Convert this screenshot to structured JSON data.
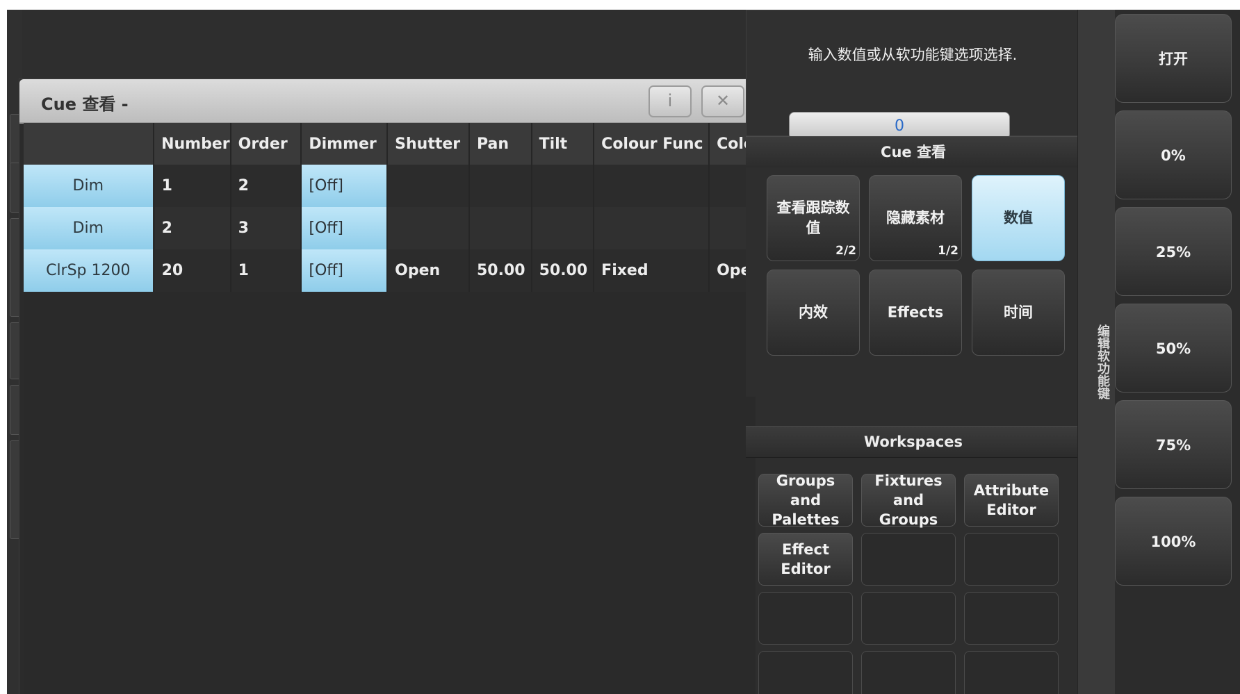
{
  "window": {
    "title": "Cue 查看 -",
    "info_button": "i",
    "close_button": "✕"
  },
  "table": {
    "columns": [
      "",
      "Number",
      "Order",
      "Dimmer",
      "Shutter",
      "Pan",
      "Tilt",
      "Colour Func",
      "Colo"
    ],
    "rows": [
      [
        "Dim",
        "1",
        "2",
        "[Off]",
        "",
        "",
        "",
        "",
        ""
      ],
      [
        "Dim",
        "2",
        "3",
        "[Off]",
        "",
        "",
        "",
        "",
        ""
      ],
      [
        "ClrSp 1200",
        "20",
        "1",
        "[Off]",
        "Open",
        "50.00",
        "50.00",
        "Fixed",
        "Ope"
      ]
    ]
  },
  "prompt": {
    "text": "输入数值或从软功能键选项选择.",
    "input_value": "0"
  },
  "softkeys": {
    "header": "Cue 查看",
    "buttons": [
      {
        "label": "查看跟踪数值",
        "page": "2/2",
        "active": false
      },
      {
        "label": "隐藏素材",
        "page": "1/2",
        "active": false
      },
      {
        "label": "数值",
        "page": "",
        "active": true
      },
      {
        "label": "内效",
        "page": "",
        "active": false
      },
      {
        "label": "Effects",
        "page": "",
        "active": false
      },
      {
        "label": "时间",
        "page": "",
        "active": false
      }
    ]
  },
  "workspaces": {
    "header": "Workspaces",
    "buttons": [
      "Groups and Palettes",
      "Fixtures and Groups",
      "Attribute Editor",
      "Effect Editor",
      "",
      "",
      "",
      "",
      "",
      "",
      "",
      ""
    ]
  },
  "side_label": "编辑软功能键",
  "levels": [
    "打开",
    "0%",
    "25%",
    "50%",
    "75%",
    "100%"
  ]
}
